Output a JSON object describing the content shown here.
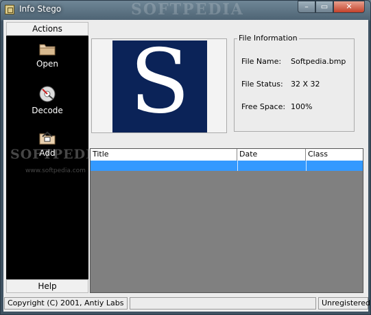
{
  "window": {
    "title": "Info Stego",
    "watermark": "SOFTPEDIA",
    "controls": {
      "minimize": "–",
      "maximize": "▭",
      "close": "✕"
    }
  },
  "actions": {
    "header": "Actions",
    "items": [
      {
        "label": "Open",
        "icon": "folder-icon"
      },
      {
        "label": "Decode",
        "icon": "decode-disc-icon"
      },
      {
        "label": "Add",
        "icon": "add-folder-icon"
      }
    ],
    "footer": "Help",
    "watermark": "SOFTPEDIA",
    "watermark_url": "www.softpedia.com"
  },
  "preview": {
    "letter": "S",
    "bg_color": "#0b2358"
  },
  "file_info": {
    "legend": "File Information",
    "rows": [
      {
        "label": "File Name:",
        "value": "Softpedia.bmp"
      },
      {
        "label": "File Status:",
        "value": "32 X 32"
      },
      {
        "label": "Free Space:",
        "value": "100%"
      }
    ]
  },
  "table": {
    "columns": [
      "Title",
      "Date",
      "Class"
    ],
    "selected_color": "#3399ff"
  },
  "status_bar": {
    "copyright": "Copyright (C) 2001, Antiy Labs",
    "middle": "",
    "registration": "Unregistered"
  }
}
